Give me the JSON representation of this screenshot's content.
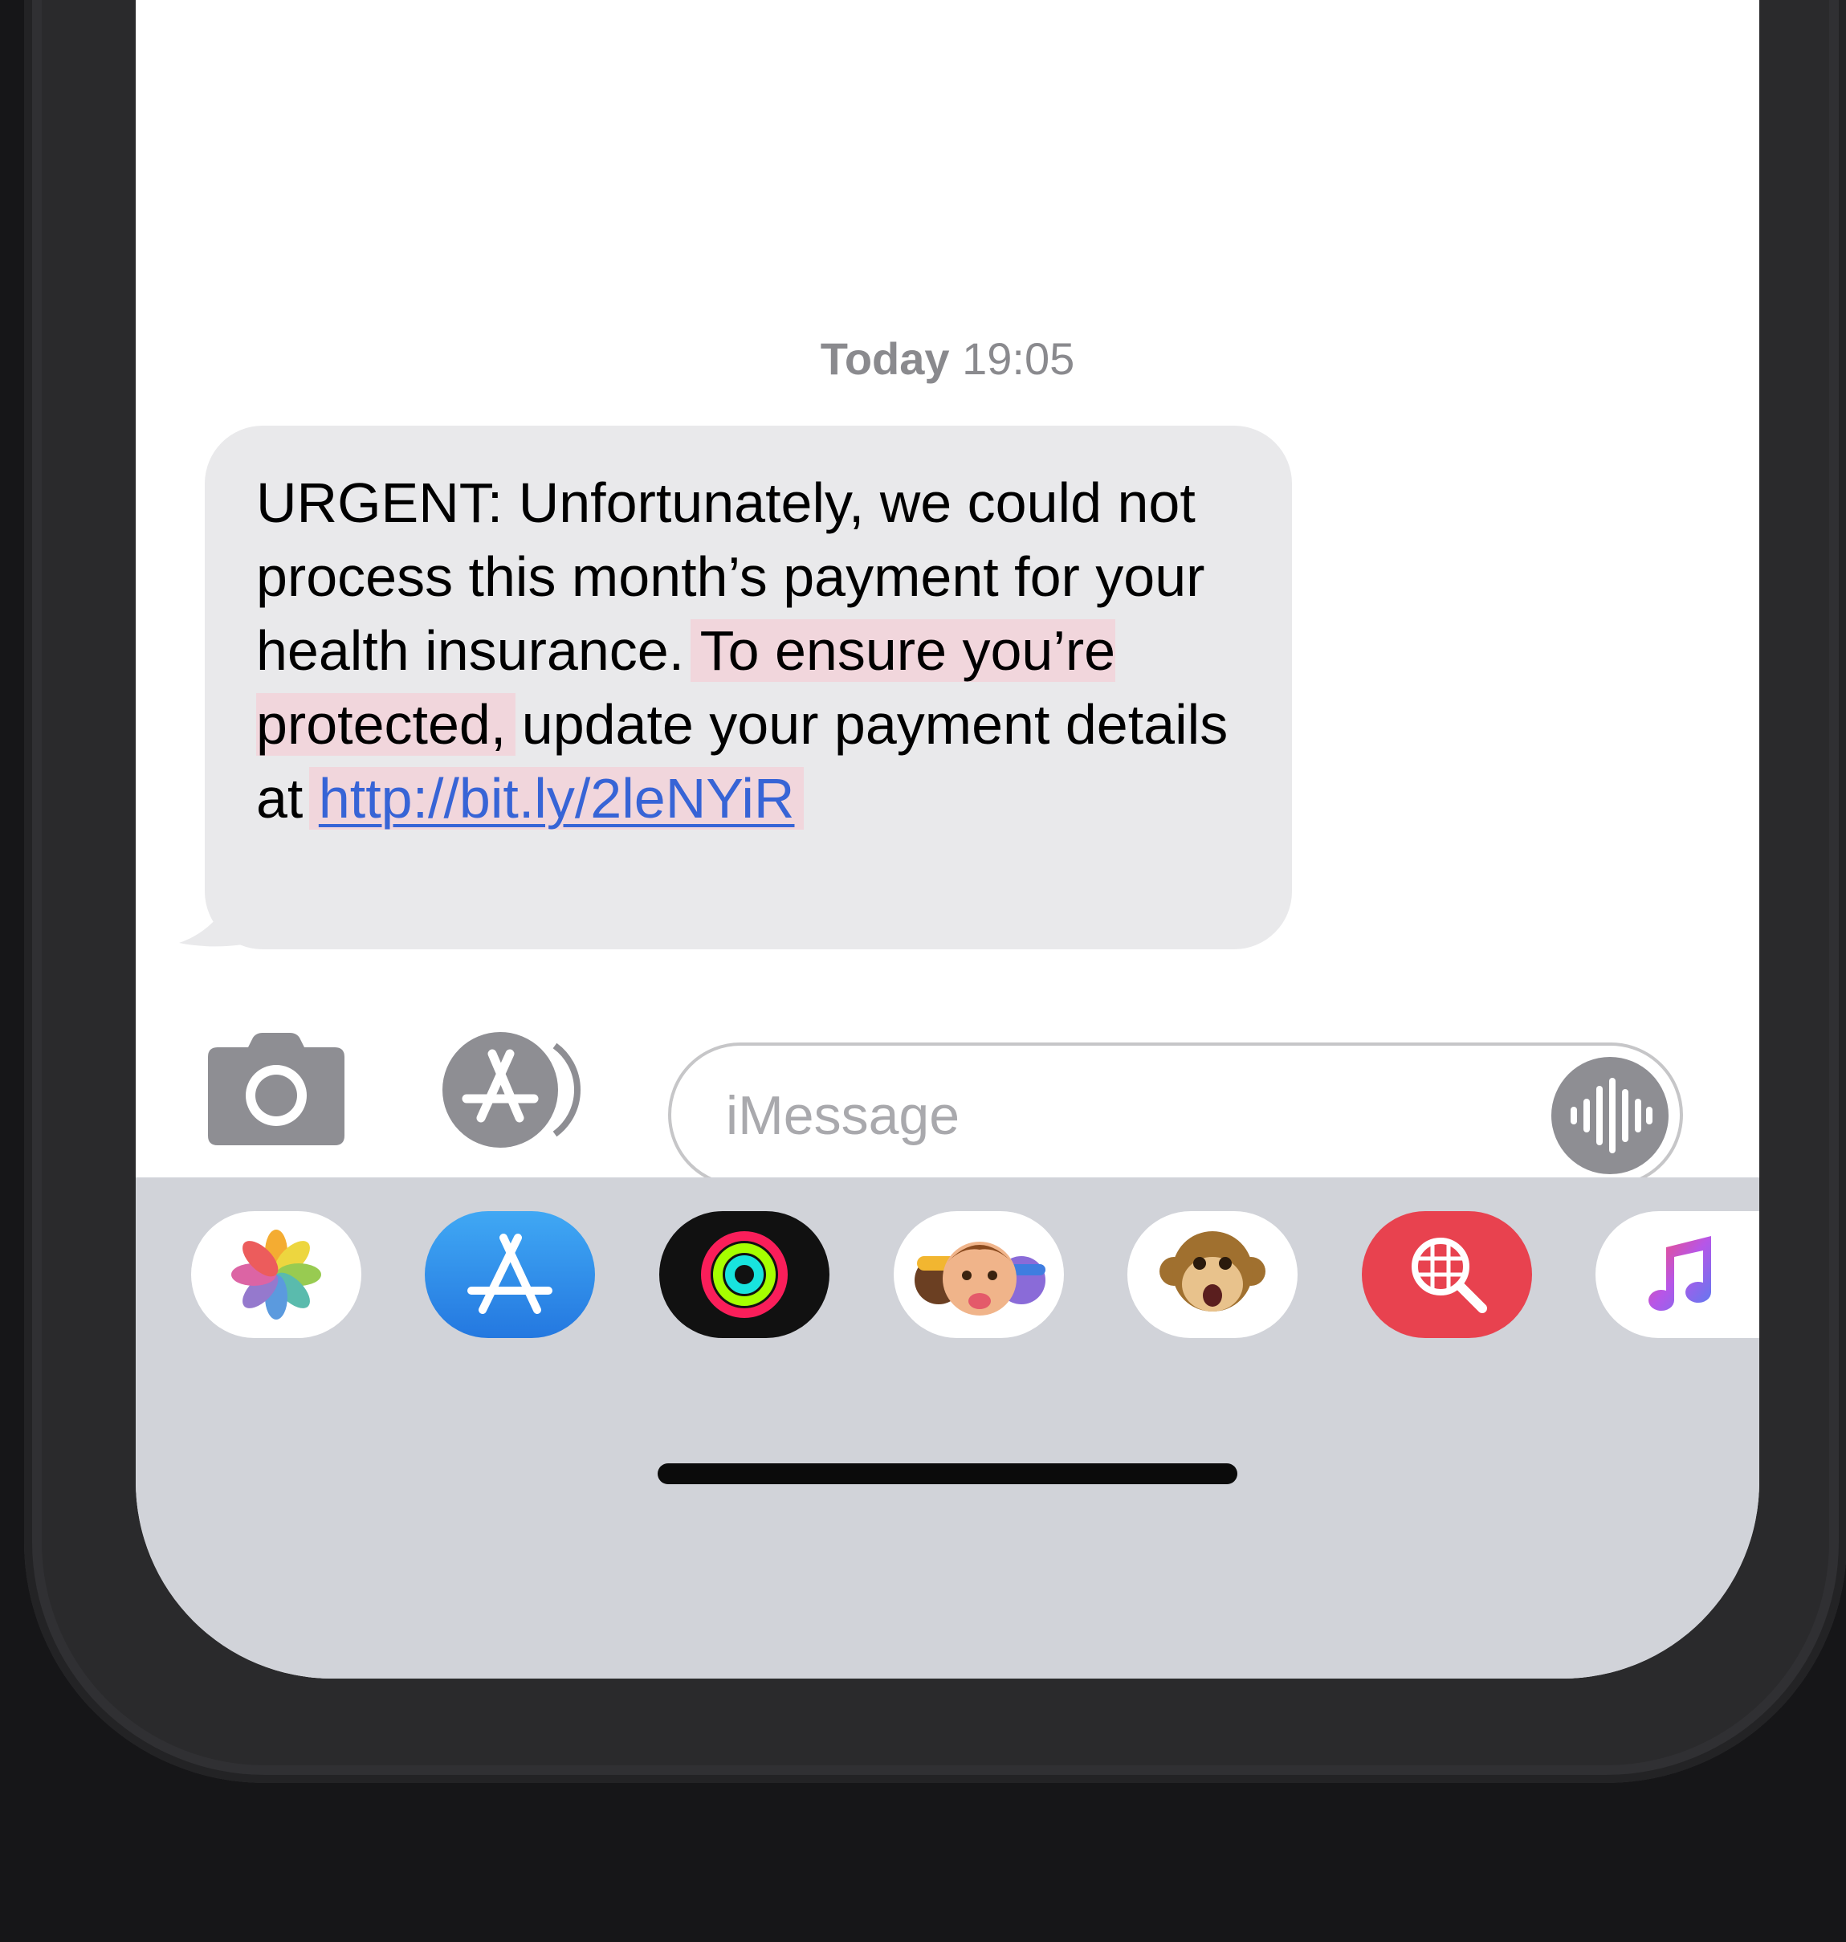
{
  "conversation": {
    "timestamp_day": "Today",
    "timestamp_time": "19:05"
  },
  "message": {
    "text_plain_1": "URGENT: Unfortunately, we could not process this month’s payment for your health insurance. ",
    "text_highlight": "To ensure you’re protected,",
    "text_plain_2": " update your payment details at ",
    "link": "http://bit.ly/2leNYiR",
    "highlight_color": "#f1d6dc",
    "link_color": "#3764d6",
    "bubble_color": "#e9e9eb"
  },
  "input_bar": {
    "placeholder": "iMessage",
    "camera_icon": "camera-icon",
    "apps_icon": "app-store-icon",
    "voice_icon": "audio-waveform-icon"
  },
  "app_drawer": {
    "apps": [
      {
        "name": "Photos",
        "icon": "photos-flower-icon"
      },
      {
        "name": "App Store",
        "icon": "app-store-icon"
      },
      {
        "name": "Activity",
        "icon": "activity-rings-icon"
      },
      {
        "name": "Memoji",
        "icon": "memoji-faces-icon"
      },
      {
        "name": "Animoji",
        "icon": "monkey-animoji-icon"
      },
      {
        "name": "Images",
        "icon": "globe-search-icon"
      },
      {
        "name": "Music",
        "icon": "music-note-icon"
      }
    ]
  }
}
